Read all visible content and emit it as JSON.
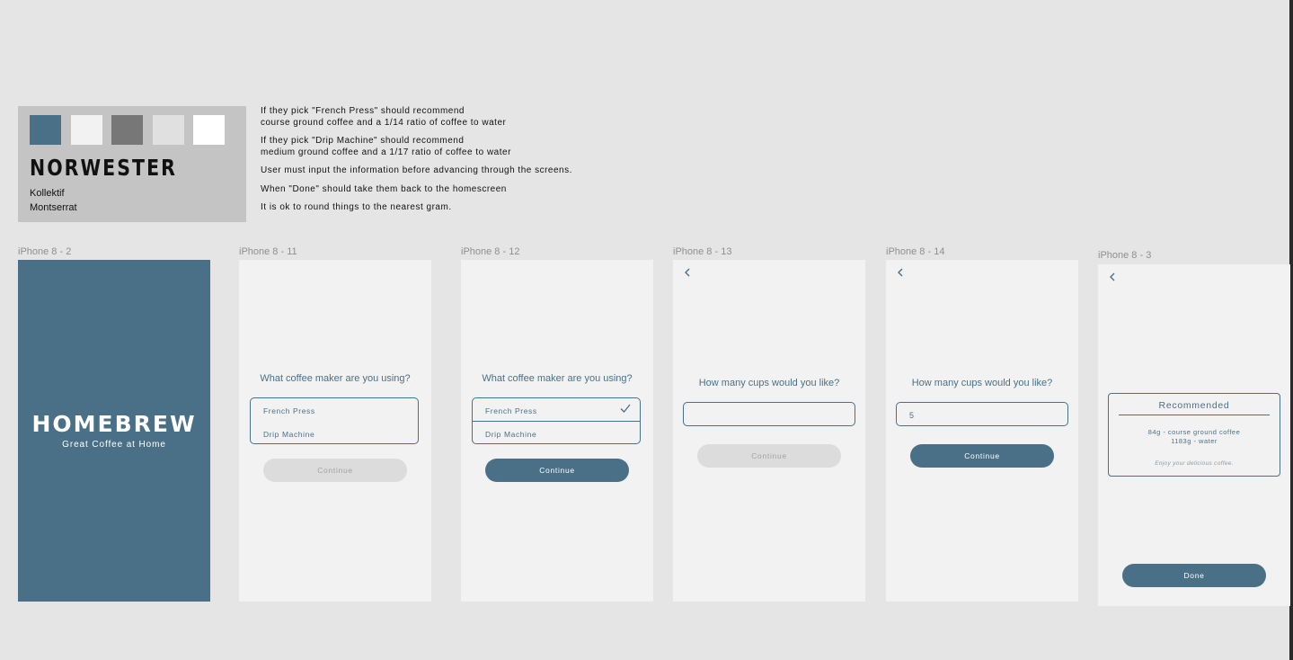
{
  "style_guide": {
    "brand": "NORWESTER",
    "fonts": [
      "Kollektif",
      "Montserrat"
    ],
    "swatches": [
      "#4a7087",
      "#f2f2f2",
      "#777777",
      "#e0e0e0",
      "#ffffff"
    ]
  },
  "notes": [
    "If they pick \"French Press\" should recommend\ncourse ground coffee and a 1/14 ratio of coffee to water",
    "If they pick \"Drip Machine\" should recommend\nmedium ground coffee and a 1/17 ratio of coffee to water",
    "User must input the information before advancing through the screens.",
    "When \"Done\" should take them back to the homescreen",
    "It is ok to round things to the nearest gram."
  ],
  "frames": {
    "f1": {
      "label": "iPhone 8 - 2",
      "logo": "HOMEBREW",
      "tagline": "Great Coffee at Home"
    },
    "f2": {
      "label": "iPhone 8 - 11",
      "question": "What coffee maker are you using?",
      "option1": "French Press",
      "option2": "Drip Machine",
      "button": "Continue"
    },
    "f3": {
      "label": "iPhone 8 - 12",
      "question": "What coffee maker are you using?",
      "option1": "French Press",
      "option2": "Drip Machine",
      "button": "Continue"
    },
    "f4": {
      "label": "iPhone 8 - 13",
      "question": "How many cups would you like?",
      "input_value": "",
      "button": "Continue"
    },
    "f5": {
      "label": "iPhone 8 - 14",
      "question": "How many cups would you like?",
      "input_value": "5",
      "button": "Continue"
    },
    "f6": {
      "label": "iPhone 8 - 3",
      "card_title": "Recommended",
      "line1": "84g - course ground coffee",
      "line2": "1183g - water",
      "enjoy": "Enjoy your delicious coffee.",
      "button": "Done"
    }
  },
  "colors": {
    "primary": "#4a7087",
    "screen_bg": "#f2f2f2",
    "disabled": "#dcdcdc",
    "canvas": "#e5e5e5"
  }
}
